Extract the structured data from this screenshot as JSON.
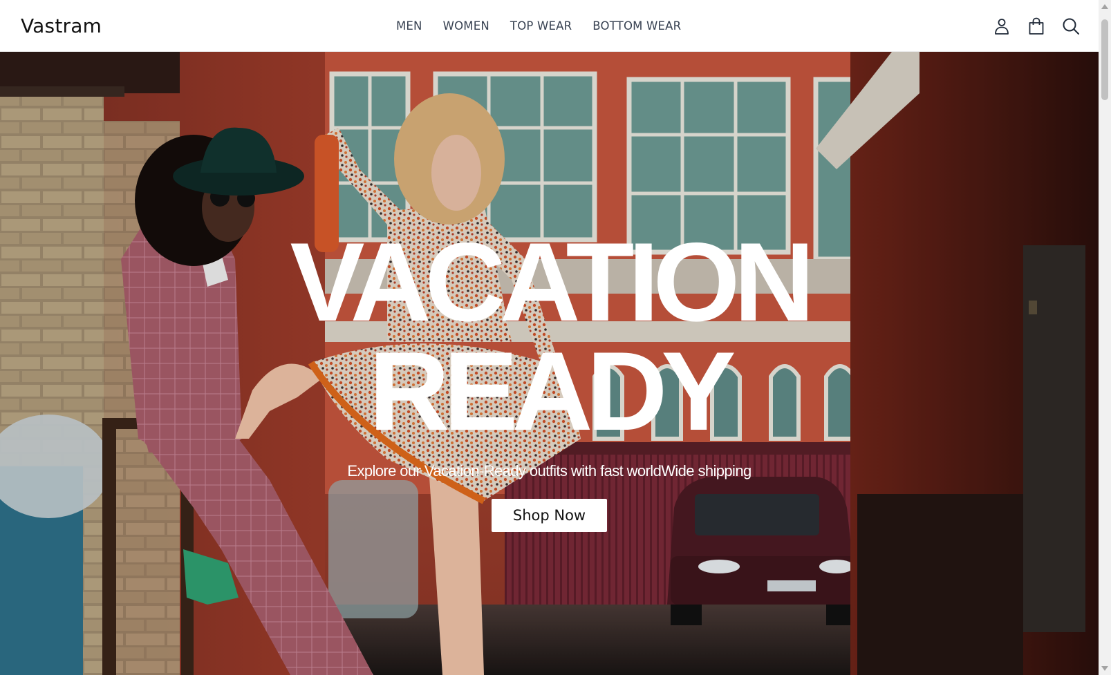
{
  "brand": {
    "name": "Vastram"
  },
  "nav": {
    "links": [
      {
        "label": "MEN"
      },
      {
        "label": "WOMEN"
      },
      {
        "label": "TOP WEAR"
      },
      {
        "label": "BOTTOM WEAR"
      }
    ],
    "icons": [
      "user-icon",
      "shopping-bag-icon",
      "search-icon"
    ]
  },
  "hero": {
    "title_line1": "VACATION",
    "title_line2": "READY",
    "subtitle": "Explore our Vacation-Ready outfits with fast worldWide shipping",
    "cta_label": "Shop Now"
  },
  "colors": {
    "nav_text": "#374151",
    "brand_text": "#111111",
    "hero_text": "#ffffff",
    "button_bg": "#ffffff"
  }
}
